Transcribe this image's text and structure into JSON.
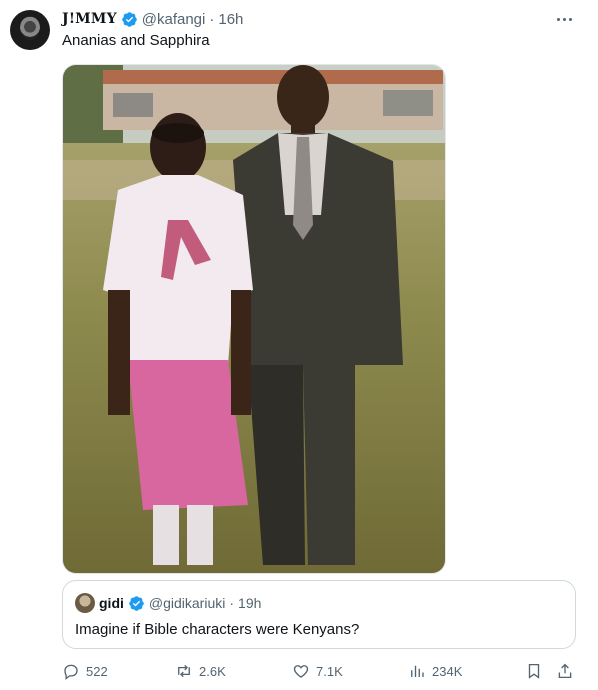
{
  "tweet": {
    "author_name": "J!MMY",
    "handle": "@kafangi",
    "separator": "·",
    "time": "16h",
    "text": "Ananias and Sapphira"
  },
  "quoted": {
    "author_name": "gidi",
    "handle": "@gidikariuki",
    "separator": "·",
    "time": "19h",
    "text": "Imagine if Bible characters were Kenyans?"
  },
  "actions": {
    "replies": "522",
    "retweets": "2.6K",
    "likes": "7.1K",
    "views": "234K"
  },
  "colors": {
    "verified": "#1d9bf0",
    "muted": "#536471",
    "text": "#0f1419",
    "border": "#cfd9de"
  }
}
